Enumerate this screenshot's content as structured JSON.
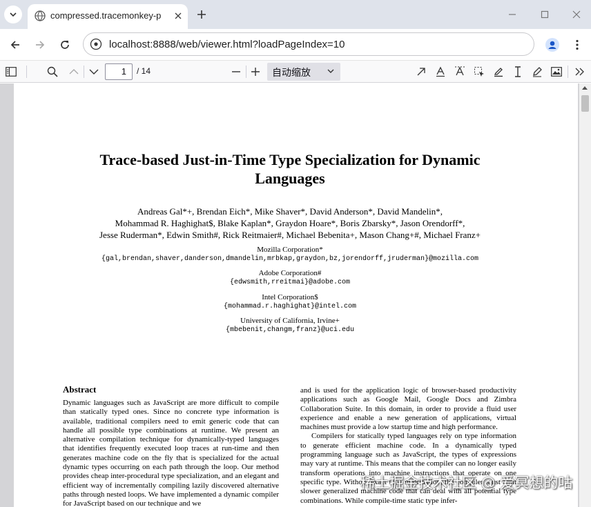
{
  "browser": {
    "tab_title": "compressed.tracemonkey-pld",
    "url": "localhost:8888/web/viewer.html?loadPageIndex=10"
  },
  "toolbar": {
    "page_number": "1",
    "page_count": "/ 14",
    "zoom_label": "自动缩放"
  },
  "paper": {
    "title_line1": "Trace-based Just-in-Time Type Specialization for Dynamic",
    "title_line2": "Languages",
    "authors_line1": "Andreas Gal*+, Brendan Eich*, Mike Shaver*, David Anderson*, David Mandelin*,",
    "authors_line2": "Mohammad R. Haghighat$, Blake Kaplan*, Graydon Hoare*, Boris Zbarsky*, Jason Orendorff*,",
    "authors_line3": "Jesse Ruderman*, Edwin Smith#, Rick Reitmaier#, Michael Bebenita+, Mason Chang+#, Michael Franz+",
    "affiliations": [
      {
        "org": "Mozilla Corporation*",
        "email": "{gal,brendan,shaver,danderson,dmandelin,mrbkap,graydon,bz,jorendorff,jruderman}@mozilla.com"
      },
      {
        "org": "Adobe Corporation#",
        "email": "{edwsmith,rreitmai}@adobe.com"
      },
      {
        "org": "Intel Corporation$",
        "email": "{mohammad.r.haghighat}@intel.com"
      },
      {
        "org": "University of California, Irvine+",
        "email": "{mbebenit,changm,franz}@uci.edu"
      }
    ],
    "abstract_heading": "Abstract",
    "abstract_text": "Dynamic languages such as JavaScript are more difficult to compile than statically typed ones. Since no concrete type information is available, traditional compilers need to emit generic code that can handle all possible type combinations at runtime. We present an alternative compilation technique for dynamically-typed languages that identifies frequently executed loop traces at run-time and then generates machine code on the fly that is specialized for the actual dynamic types occurring on each path through the loop. Our method provides cheap inter-procedural type specialization, and an elegant and efficient way of incrementally compiling lazily discovered alternative paths through nested loops. We have implemented a dynamic compiler for JavaScript based on our technique and we",
    "right_para1": "and is used for the application logic of browser-based productivity applications such as Google Mail, Google Docs and Zimbra Collaboration Suite. In this domain, in order to provide a fluid user experience and enable a new generation of applications, virtual machines must provide a low startup time and high performance.",
    "right_para2": "Compilers for statically typed languages rely on type information to generate efficient machine code. In a dynamically typed programming language such as JavaScript, the types of expressions may vary at runtime. This means that the compiler can no longer easily transform operations into machine instructions that operate on one specific type. Without exact type information, the compiler must emit slower generalized machine code that can deal with all potential type combinations. While compile-time static type infer-"
  },
  "watermark": "稀土掘金技术社区 @ 爱冥想的咕",
  "colors": {
    "tab_strip": "#dfe3eb",
    "viewer_bg": "#d4d4d7",
    "toolbar_bg": "#f9f9fa"
  }
}
